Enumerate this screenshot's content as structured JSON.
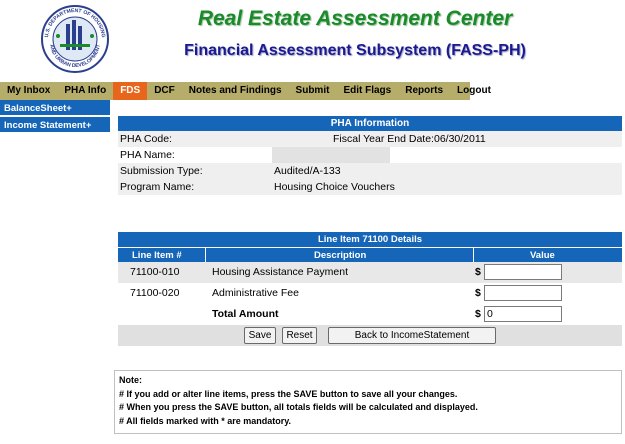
{
  "header": {
    "title": "Real Estate Assessment Center",
    "subtitle": "Financial Assessment Subsystem (FASS-PH)",
    "seal": {
      "text_top": "U.S. DEPARTMENT OF HOUSING",
      "text_bottom": "AND URBAN DEVELOPMENT"
    }
  },
  "nav": {
    "items": [
      "My Inbox",
      "PHA Info",
      "FDS",
      "DCF",
      "Notes and Findings",
      "Submit",
      "Edit Flags",
      "Reports",
      "Logout"
    ],
    "active_index": 2
  },
  "sidebar": {
    "items": [
      {
        "label": "BalanceSheet+"
      },
      {
        "label": "Income Statement+"
      }
    ]
  },
  "pha_info": {
    "header": "PHA Information",
    "pha_code_label": "PHA Code:",
    "pha_code_value": "",
    "fiscal_year_label": "Fiscal Year End Date:06/30/2011",
    "pha_name_label": "PHA Name:",
    "pha_name_value": "",
    "submission_type_label": "Submission Type:",
    "submission_type_value": "Audited/A-133",
    "program_name_label": "Program Name:",
    "program_name_value": "Housing Choice Vouchers"
  },
  "line_item": {
    "header": "Line Item 71100 Details",
    "columns": {
      "line_item": "Line Item #",
      "description": "Description",
      "value": "Value"
    },
    "rows": [
      {
        "line": "71100-010",
        "description": "Housing Assistance Payment",
        "currency": "$",
        "value": ""
      },
      {
        "line": "71100-020",
        "description": "Administrative Fee",
        "currency": "$",
        "value": ""
      }
    ],
    "total": {
      "label": "Total Amount",
      "currency": "$",
      "value": "0"
    },
    "buttons": {
      "save": "Save",
      "reset": "Reset",
      "back": "Back to IncomeStatement"
    }
  },
  "note": {
    "title": "Note:",
    "lines": [
      "# If you add or alter line items, press the SAVE button to save all your changes.",
      "# When you press the SAVE button, all totals fields will be calculated and displayed.",
      "# All fields marked with * are mandatory."
    ]
  },
  "colors": {
    "nav_bg": "#b7ad6b",
    "nav_active": "#e8661c",
    "panel_blue": "#1565b8",
    "title_green": "#1a8a2a",
    "subtitle_blue": "#1a1a8e"
  }
}
